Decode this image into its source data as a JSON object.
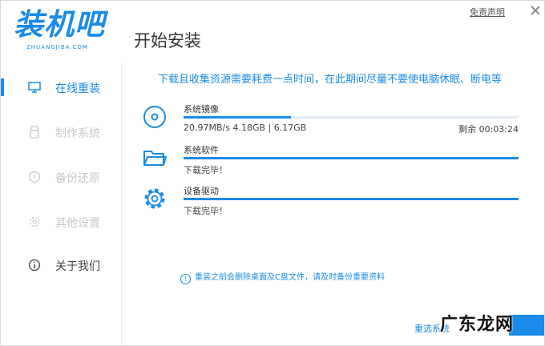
{
  "app": {
    "logo_text": "装机吧",
    "logo_sub": "ZHUANGJIBA.COM",
    "page_title": "开始安装",
    "disclaimer": "免责声明",
    "brand_color": "#1a8be6"
  },
  "sidebar": {
    "items": [
      {
        "label": "在线重装",
        "icon": "monitor-icon",
        "state": "active"
      },
      {
        "label": "制作系统",
        "icon": "usb-icon",
        "state": "disabled"
      },
      {
        "label": "备份还原",
        "icon": "restore-icon",
        "state": "disabled"
      },
      {
        "label": "其他设置",
        "icon": "gear-icon",
        "state": "disabled"
      },
      {
        "label": "关于我们",
        "icon": "info-icon",
        "state": "normal"
      }
    ]
  },
  "main": {
    "notice": "下载且收集资源需要耗费一点时间，在此期间尽量不要使电脑休眠、断电等",
    "tasks": [
      {
        "name": "系统镜像",
        "status": "20.97MB/s 4.18GB | 6.17GB",
        "remaining": "剩余 00:03:24",
        "progress": 0.32,
        "icon": "disc-icon"
      },
      {
        "name": "系统软件",
        "status": "下载完毕！",
        "remaining": "",
        "progress": 1.0,
        "icon": "folder-icon"
      },
      {
        "name": "设备驱动",
        "status": "下载完毕！",
        "remaining": "",
        "progress": 1.0,
        "icon": "gear-icon"
      }
    ],
    "warning": "重装之前会删除桌面及C盘文件，请及时备份重要资料",
    "reselect": "重选系统",
    "watermark": "广东龙网"
  }
}
